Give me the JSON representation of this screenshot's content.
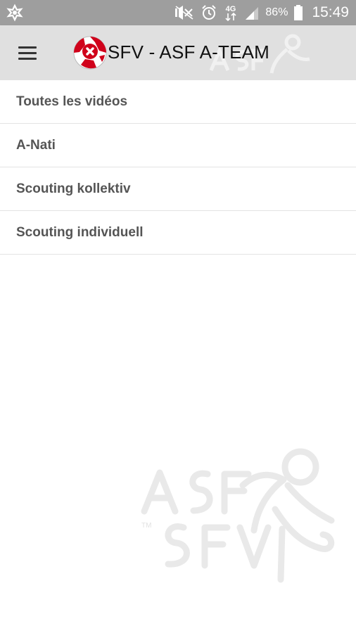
{
  "status_bar": {
    "battery_percent": "86%",
    "time": "15:49",
    "network_type": "4G",
    "icons": [
      "app-notification-icon",
      "mute-icon",
      "alarm-icon",
      "network-4g-icon",
      "signal-icon",
      "battery-icon"
    ]
  },
  "app_bar": {
    "title": "SFV - ASF A-TEAM",
    "menu_icon": "hamburger-menu-icon",
    "logo": "swiss-football-logo"
  },
  "menu": {
    "items": [
      {
        "label": "Toutes les vidéos"
      },
      {
        "label": "A-Nati"
      },
      {
        "label": "Scouting kollektiv"
      },
      {
        "label": "Scouting individuell"
      }
    ]
  },
  "colors": {
    "status_bar_bg": "#9e9e9e",
    "app_bar_bg": "#e0e0e0",
    "list_text": "#555555",
    "logo_red": "#d0021b"
  }
}
